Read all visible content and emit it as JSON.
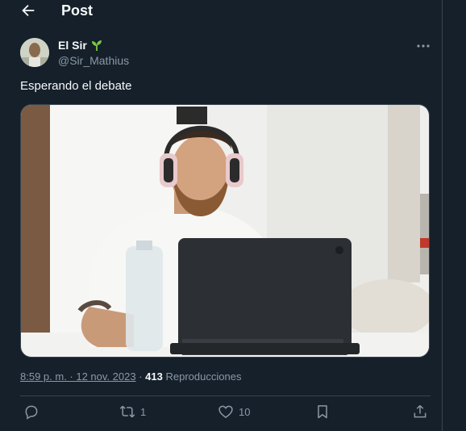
{
  "header": {
    "title": "Post",
    "back_icon": "arrow-left-icon"
  },
  "author": {
    "name": "El Sir",
    "badge_icon": "seedling-icon",
    "handle": "@Sir_Mathius",
    "more_icon": "ellipsis-icon"
  },
  "post": {
    "text": "Esperando el debate",
    "media_icon": "photo-of-man-with-headphones-and-laptop"
  },
  "meta": {
    "time": "8:59 p. m. · 12 nov. 2023",
    "separator": "·",
    "views_count": "413",
    "views_label": "Reproducciones"
  },
  "actions": {
    "reply": {
      "icon": "reply-icon",
      "count": ""
    },
    "repost": {
      "icon": "repost-icon",
      "count": "1"
    },
    "like": {
      "icon": "heart-icon",
      "count": "10"
    },
    "bookmark": {
      "icon": "bookmark-icon",
      "count": ""
    },
    "share": {
      "icon": "share-icon",
      "count": ""
    }
  },
  "colors": {
    "background": "#15202b",
    "text": "#f7f9f9",
    "muted": "#8b98a5",
    "border": "#38444d",
    "badge": "#7ac943"
  }
}
